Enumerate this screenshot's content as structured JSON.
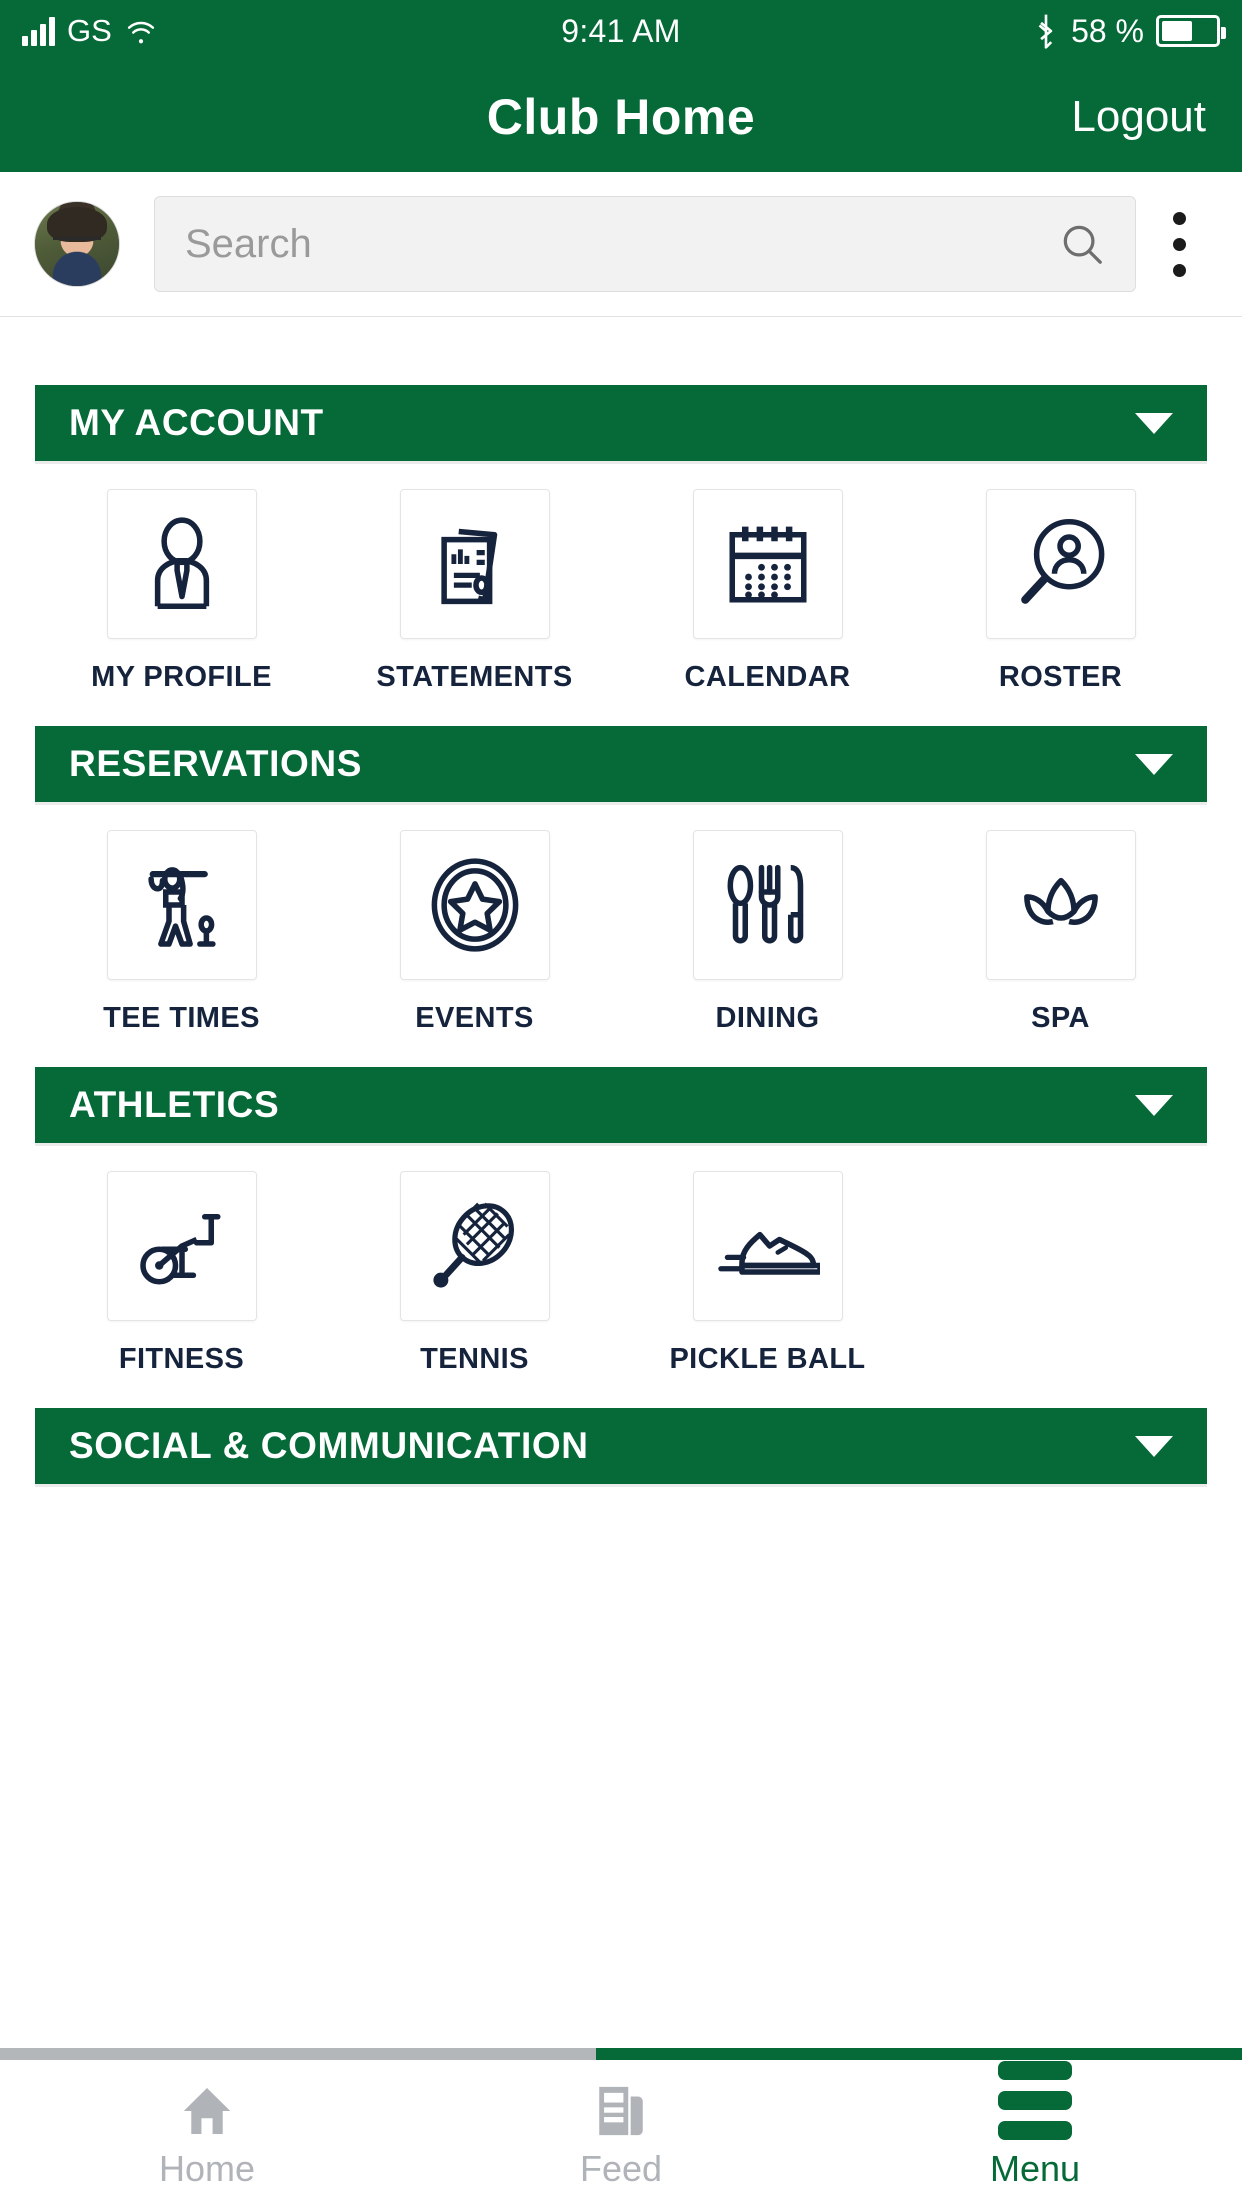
{
  "status_bar": {
    "carrier": "GS",
    "time": "9:41 AM",
    "battery_percent": "58 %",
    "signal_icon": "signal-bars-icon",
    "wifi_icon": "wifi-icon",
    "bluetooth_icon": "bluetooth-icon",
    "battery_icon": "battery-icon"
  },
  "nav": {
    "title": "Club Home",
    "logout_label": "Logout"
  },
  "search": {
    "placeholder": "Search",
    "value": "",
    "icon": "search-icon",
    "overflow_icon": "kebab-menu-icon",
    "avatar": "user-avatar"
  },
  "sections": [
    {
      "title": "MY ACCOUNT",
      "expanded": true,
      "caret": "chevron-down-icon",
      "tiles": [
        {
          "label": "MY PROFILE",
          "icon": "person-tie-icon"
        },
        {
          "label": "STATEMENTS",
          "icon": "documents-icon"
        },
        {
          "label": "CALENDAR",
          "icon": "calendar-icon"
        },
        {
          "label": "ROSTER",
          "icon": "person-search-icon"
        }
      ]
    },
    {
      "title": "RESERVATIONS",
      "expanded": true,
      "caret": "chevron-down-icon",
      "tiles": [
        {
          "label": "TEE TIMES",
          "icon": "golfer-icon"
        },
        {
          "label": "EVENTS",
          "icon": "star-badge-icon"
        },
        {
          "label": "DINING",
          "icon": "cutlery-icon"
        },
        {
          "label": "SPA",
          "icon": "lotus-icon"
        }
      ]
    },
    {
      "title": "ATHLETICS",
      "expanded": true,
      "caret": "chevron-down-icon",
      "tiles": [
        {
          "label": "FITNESS",
          "icon": "exercise-bike-icon"
        },
        {
          "label": "TENNIS",
          "icon": "tennis-racket-icon"
        },
        {
          "label": "PICKLE BALL",
          "icon": "sneaker-icon"
        }
      ]
    },
    {
      "title": "SOCIAL & COMMUNICATION",
      "expanded": false,
      "caret": "chevron-down-icon",
      "tiles": []
    }
  ],
  "tabbar": {
    "items": [
      {
        "label": "Home",
        "icon": "home-icon",
        "active": false
      },
      {
        "label": "Feed",
        "icon": "newspaper-icon",
        "active": false
      },
      {
        "label": "Menu",
        "icon": "hamburger-icon",
        "active": true
      }
    ]
  },
  "colors": {
    "brand_green": "#056A38",
    "icon_navy": "#16233c",
    "inactive_gray": "#b0b4b8"
  }
}
